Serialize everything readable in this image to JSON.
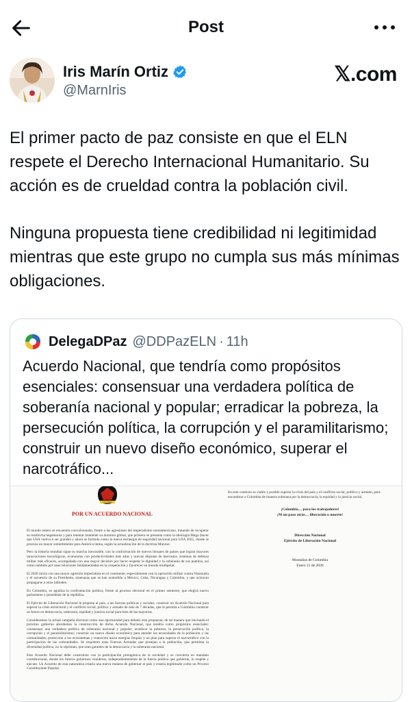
{
  "header": {
    "title": "Post",
    "back_icon": "arrow-left-icon",
    "more_icon": "more-horizontal-icon"
  },
  "author": {
    "name": "Iris Marín Ortiz",
    "handle": "@MarnIris",
    "verified": true,
    "verified_color": "#1d9bf0"
  },
  "source_label": "𝕏.com",
  "tweet": {
    "paragraphs": [
      "El primer pacto de paz consiste en que el ELN respete el Derecho Internacional Humanitario. Su acción es de crueldad contra la población civil.",
      "Ninguna propuesta tiene credibilidad ni legitimidad mientras que este grupo no cumpla sus más mínimas obligaciones."
    ]
  },
  "quoted": {
    "name": "DelegaDPaz",
    "handle": "@DDPazELN",
    "separator": "·",
    "time": "11h",
    "text": "Acuerdo Nacional, que tendría como propósitos esenciales: consensuar una verdadera política de soberanía nacional y popular; erradicar la pobreza, la persecución política, la corrupción y el paramilitarismo; construir un nuevo diseño económico, superar el narcotráfico...",
    "document": {
      "title": "POR UN ACUERDO NACIONAL",
      "left_paragraphs": [
        "El mundo entero se encuentra convulsionado, frente a las agresiones del imperialismo norteamericano, tratando de recuperar su maltrecha hegemonía y para intentar mantener su dominio global, que primero se presenta como la ideología Maga (hacer que USA vuelva a ser grande) y ahora se formula como la nueva estrategia de seguridad nacional para USA 2025, donde se prioriza un mayor sometimiento para América latina, según la actualización de la doctrina Monroe.",
        "Pero la historia mundial sigue su marcha inexorable, con la conformación de nuevos bloques de países que logran mayores innovaciones tecnológicas, economías con productividades más altas y nuevas disputas de mercados, sistemas de defensa militar más eficaces, acompañada con una mayor decisión por hacer respetar la dignidad y la soberanía de sus pueblos, así como también por unas relaciones fundamentadas en la cooperación y favorecer un mundo multipolar.",
        "El 2026 inicia con una mayor agresión imperialista en el continente, especialmente con la operación militar contra Venezuela y el secuestro de su Presidente, amenazas que se han extendido a México, Cuba, Nicaragua y Colombia, y que avizoran propagarse a otras latitudes.",
        "En Colombia, se agudiza la confrontación política, frente al proceso electoral en el primer semestre, que elegirá nuevo parlamento y presidente de la república.",
        "El Ejército de Liberación Nacional le propone al país, a las fuerzas políticas y sociales, construir un Acuerdo Nacional para superar la crisis estructural y el conflicto social, político y armado de más de 7 décadas, que le permita a Colombia construir su futuro en democracia, soberanía, equidad y justicia social para bien de las mayorías.",
        "Consideramos la actual campaña electoral como una oportunidad para debatir esta propuesta, de tal manera que iniciando el próximo gobierno abordemos la construcción de dicho Acuerdo Nacional, que tendría como propósitos esenciales: consensuar una verdadera política de soberanía nacional y popular; erradicar la pobreza, la persecución política, la corrupción y el paramilitarismo; construir un nuevo diseño económico para atender las necesidades de la población y las comunidades; protección a los ecosistemas y transición hacia energías limpias y un plan para superar el narcotráfico con la participación de las comunidades. Se requieren unas Fuerzas Armadas que protejan a la población, que permitan la diversidad política, no la repriman, que sean garantes de la democracia y la soberanía nacional.",
        "Este Acuerdo Nacional debe construirse con la participación protagónica de la sociedad y se convierta en mandato constitucional, donde los futuros gobiernos venideros, independientemente de la fuerza política que gobierne, lo respete y ejecute. Un Acuerdo de esta naturaleza crearía una nueva manera de gobernar al país y estaría legitimado como un Proceso Constituyente Popular."
      ],
      "right_intro": "En este contexto es viable y posible superar la crisis del país y el conflicto social, político y armado, para encumbrar a Colombia de manera soberana por la democracia, la equidad y la justicia social.",
      "slogan_lines": [
        "¡Colombia… para los trabajadores!",
        "¡Ni un paso atrás… liberación o muerte!"
      ],
      "signature_lines": [
        "Dirección Nacional",
        "Ejército de Liberación Nacional"
      ],
      "place_date_lines": [
        "Montañas de Colombia",
        "Enero 11 de 2026"
      ],
      "logo_text": "COLOMBIA",
      "accent_color": "#c0241a"
    }
  }
}
